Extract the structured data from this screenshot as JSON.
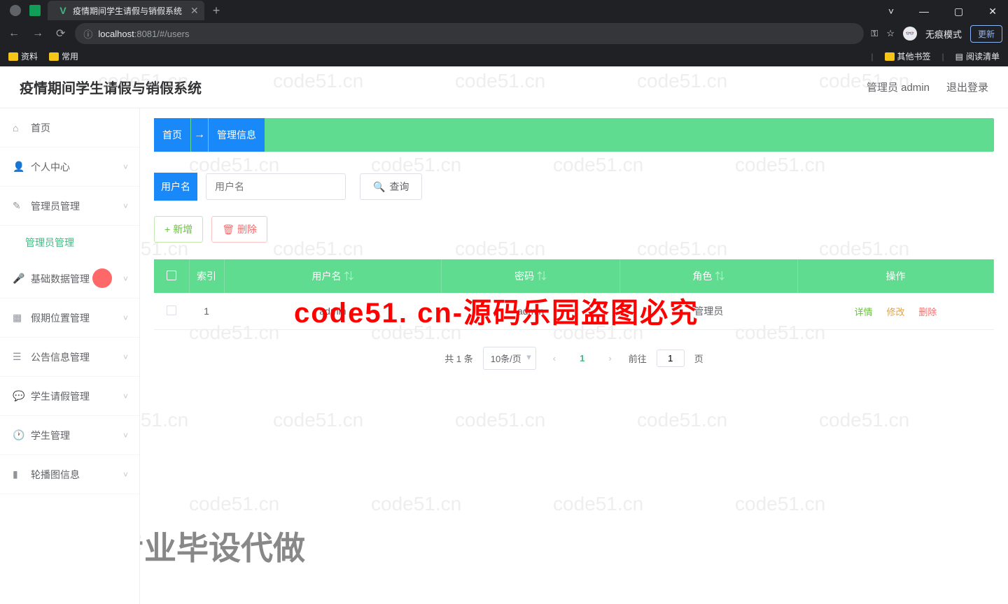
{
  "browser": {
    "tab_title": "疫情期间学生请假与销假系统",
    "url_info": "ⓘ",
    "url_host": "localhost",
    "url_port_path": ":8081/#/users",
    "incognito_label": "无痕模式",
    "update_label": "更新",
    "bookmarks": {
      "left": [
        "资料",
        "常用"
      ],
      "right": [
        "其他书签",
        "阅读清单"
      ]
    },
    "window_controls": [
      "˅",
      "—",
      "▢",
      "✕"
    ]
  },
  "header": {
    "app_title": "疫情期间学生请假与销假系统",
    "user_label": "管理员 admin",
    "logout_label": "退出登录"
  },
  "sidebar": {
    "items": [
      {
        "icon": "⌂",
        "label": "首页",
        "sub": false
      },
      {
        "icon": "👤",
        "label": "个人中心",
        "sub": true
      },
      {
        "icon": "✎",
        "label": "管理员管理",
        "sub": true
      },
      {
        "icon": "🎤",
        "label": "基础数据管理",
        "sub": true
      },
      {
        "icon": "▦",
        "label": "假期位置管理",
        "sub": true
      },
      {
        "icon": "☰",
        "label": "公告信息管理",
        "sub": true
      },
      {
        "icon": "💬",
        "label": "学生请假管理",
        "sub": true
      },
      {
        "icon": "🕐",
        "label": "学生管理",
        "sub": true
      },
      {
        "icon": "▮",
        "label": "轮播图信息",
        "sub": true
      }
    ],
    "submenu_active": "管理员管理"
  },
  "breadcrumb": {
    "home": "首页",
    "arrow": "→",
    "current": "管理信息"
  },
  "search": {
    "label": "用户名",
    "placeholder": "用户名",
    "query_btn": "查询"
  },
  "actions": {
    "add": "新增",
    "delete": "删除"
  },
  "table": {
    "headers": [
      "",
      "索引",
      "用户名",
      "密码",
      "角色",
      "操作"
    ],
    "rows": [
      {
        "index": "1",
        "username": "admin",
        "password": "admin",
        "role": "管理员"
      }
    ],
    "ops": {
      "detail": "详情",
      "edit": "修改",
      "delete": "删除"
    }
  },
  "pagination": {
    "total_text": "共 1 条",
    "page_size": "10条/页",
    "current": "1",
    "goto_label": "前往",
    "goto_value": "1",
    "page_suffix": "页"
  },
  "watermarks": {
    "text": "code51.cn",
    "big": "code51. cn-源码乐园盗图必究",
    "footer": "专业毕设代做"
  }
}
